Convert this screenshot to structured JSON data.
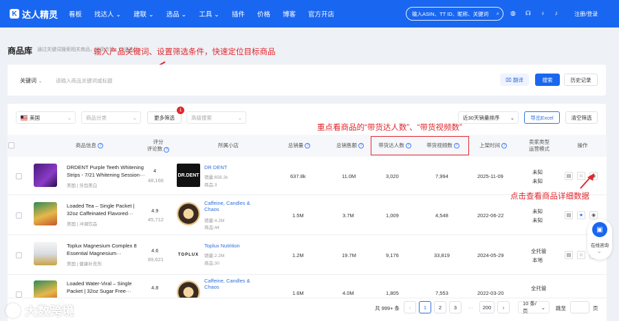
{
  "nav": {
    "logo_mark": "K",
    "brand": "达人精灵",
    "menu": [
      "看板",
      "找达人 ⌄",
      "建联 ⌄",
      "选品 ⌄",
      "工具 ⌄",
      "插件",
      "价格",
      "博客",
      "官方开店"
    ],
    "search_placeholder": "输入ASIN、TT ID、昵称、关键词",
    "login": "注册/登录"
  },
  "page": {
    "title": "商品库",
    "subtitle": "通过关键词搜索相关商品，发现市场，快速选品"
  },
  "annotations": {
    "top": "输入产品关键词、设置筛选条件，快速定位目标商品",
    "middle": "重点看商品的“带货达人数”、“带货视频数”",
    "right": "点击查看商品详细数据"
  },
  "search_bar": {
    "keyword_label": "关键词",
    "keyword_placeholder": "请输入商品关键词或标题",
    "translate": "翻译",
    "search": "搜索",
    "history": "历史记录"
  },
  "filters": {
    "country": "美国",
    "category": "商品分类",
    "more": "更多筛选",
    "more_badge": "1",
    "advanced": "高级搜索",
    "sort": "近30天销量排序",
    "export": "导出Excel",
    "clear": "清空筛选"
  },
  "table": {
    "headers": {
      "product": "商品信息",
      "rating": "评分",
      "reviews": "评论数",
      "shop": "所属小店",
      "total_sales": "总销量",
      "total_revenue": "总销售额",
      "creators": "带货达人数",
      "videos": "带货视频数",
      "launch": "上架时间",
      "seller_type": "卖家类型",
      "ops_mode": "运营模式",
      "actions": "操作"
    },
    "rows": [
      {
        "title1": "DRDENT Purple Teeth Whitening",
        "title2": "Strips - 7/21 Whitening Session···",
        "cat": "美国 | 牙齿美白",
        "rating": "4",
        "reviews": "48,166",
        "shop": "DR DENT",
        "shop_sales": "销量:658.2k",
        "shop_items": "商品:3",
        "sales": "637.8k",
        "revenue": "11.0M",
        "creators": "3,020",
        "videos": "7,994",
        "date": "2025-11-09",
        "seller": "未知",
        "mode": "未知"
      },
      {
        "title1": "Loaded Tea – Single Packet |",
        "title2": "32oz Caffeinated Flavored···",
        "cat": "美国 | 冲调饮品",
        "rating": "4.9",
        "reviews": "45,712",
        "shop": "Caffeine, Candles &",
        "shop2": "Chaos",
        "shop_sales": "销量:4.2M",
        "shop_items": "商品:44",
        "sales": "1.5M",
        "revenue": "3.7M",
        "creators": "1,009",
        "videos": "4,548",
        "date": "2022-06-22",
        "seller": "未知",
        "mode": "未知"
      },
      {
        "title1": "Toplux Magnesium Complex 8",
        "title2": "Essential Magnesium···",
        "cat": "美国 | 健康补充剂",
        "rating": "4.6",
        "reviews": "89,621",
        "shop": "Toplux Nutrition",
        "shop_sales": "销量:2.2M",
        "shop_items": "商品:30",
        "sales": "1.2M",
        "revenue": "19.7M",
        "creators": "9,176",
        "videos": "33,819",
        "date": "2024-05-29",
        "seller": "全托管",
        "mode": "本地"
      },
      {
        "title1": "Loaded Water-Viral – Single",
        "title2": "Packet | 32oz Sugar Free···",
        "rating": "4.8",
        "shop": "Caffeine, Candles &",
        "shop2": "Chaos",
        "sales": "1.6M",
        "revenue": "4.0M",
        "creators": "1,805",
        "videos": "7,553",
        "date": "2022-03-20",
        "seller": "全托管"
      }
    ]
  },
  "pagination": {
    "total": "共 999+ 条",
    "pages": [
      "1",
      "2",
      "3"
    ],
    "ellipsis": "···",
    "last": "200",
    "page_size": "10 条/页",
    "goto": "跳至",
    "page_unit": "页"
  },
  "side_widget": {
    "label": "在线咨询"
  },
  "watermark": "大数跨境"
}
